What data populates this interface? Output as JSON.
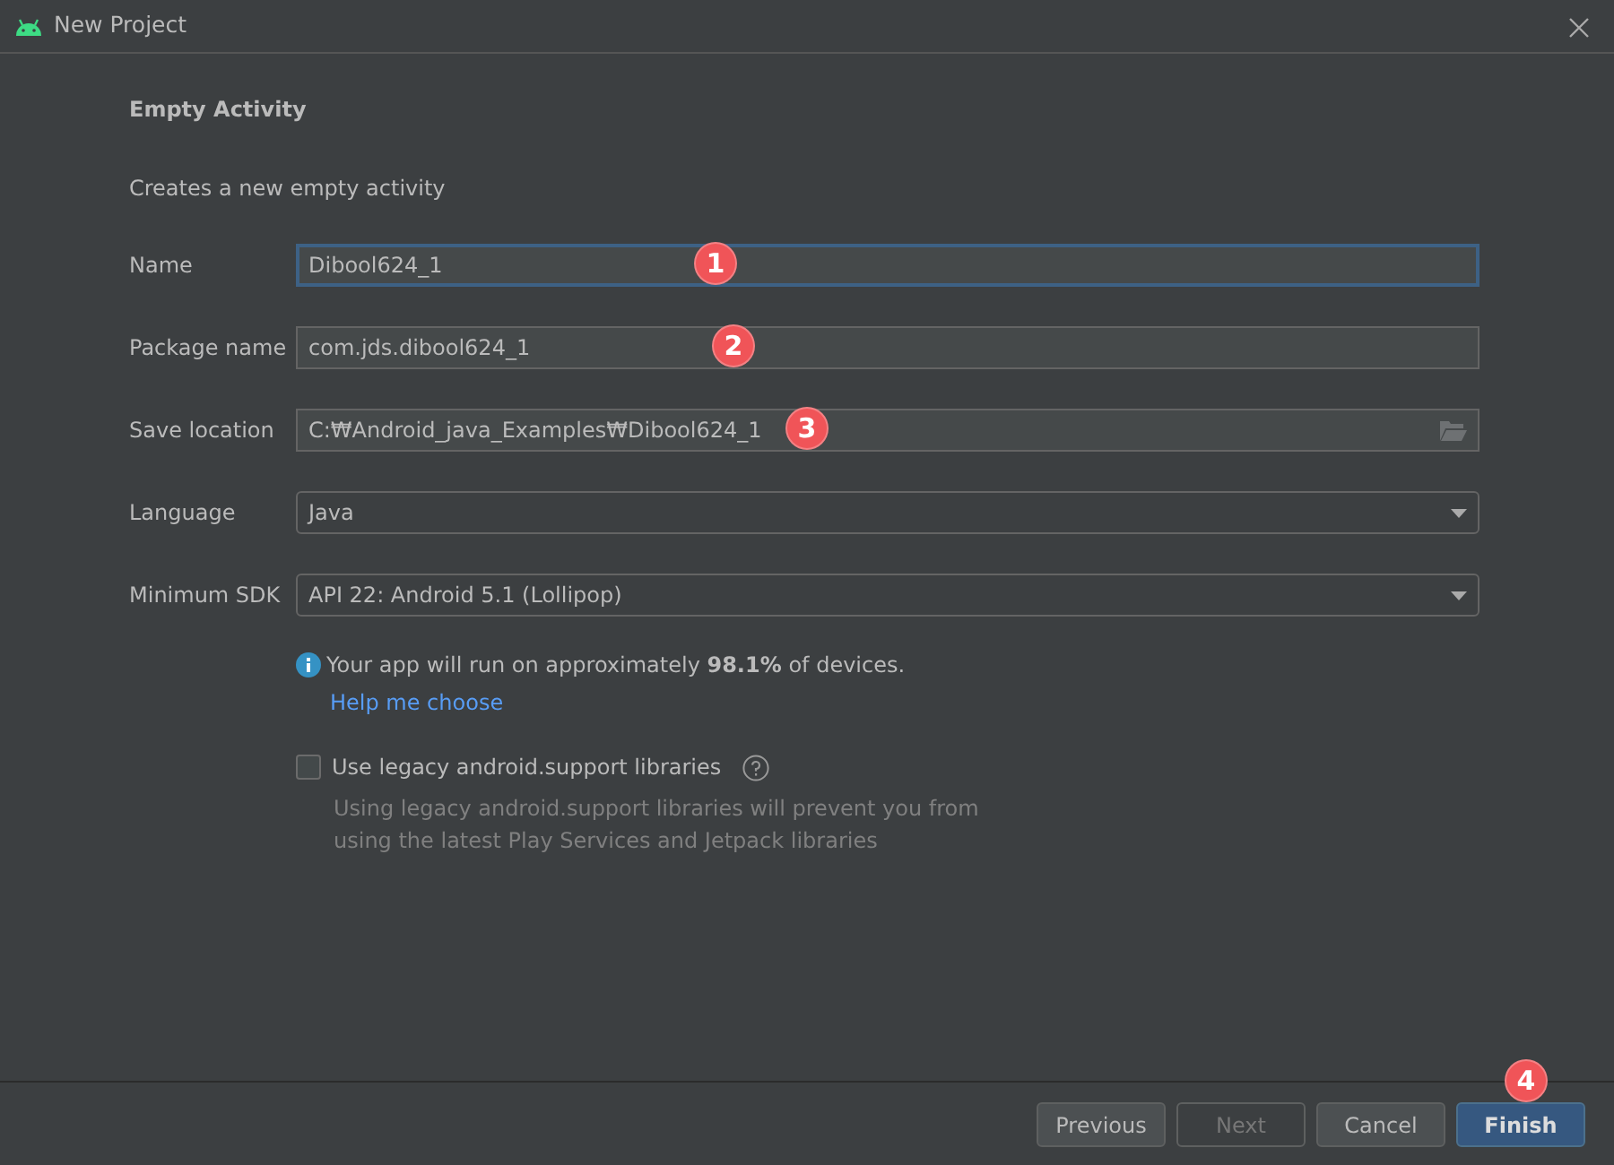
{
  "window": {
    "title": "New Project"
  },
  "heading": "Empty Activity",
  "description": "Creates a new empty activity",
  "fields": [
    {
      "label": "Name",
      "kind": "text",
      "value": "Dibool624_1",
      "focused": true,
      "marker": "1"
    },
    {
      "label": "Package name",
      "kind": "text",
      "value": "com.jds.dibool624_1",
      "focused": false,
      "marker": "2"
    },
    {
      "label": "Save location",
      "kind": "path",
      "value": "C:₩Android_java_Examples₩Dibool624_1",
      "focused": false,
      "marker": "3"
    },
    {
      "label": "Language",
      "kind": "dropdown",
      "value": "Java",
      "focused": false
    },
    {
      "label": "Minimum SDK",
      "kind": "dropdown",
      "value": "API 22: Android 5.1 (Lollipop)",
      "focused": false
    }
  ],
  "info": {
    "text": "Your app will run on approximately **98.1%** of devices.",
    "link": "Help me choose"
  },
  "legacy": {
    "label": "Use legacy android.support libraries",
    "checked": false,
    "note": "Using legacy android.support libraries will prevent you from using the latest Play Services and Jetpack libraries"
  },
  "buttons": [
    {
      "label": "Previous",
      "disabled": false,
      "primary": false
    },
    {
      "label": "Next",
      "disabled": true,
      "primary": false
    },
    {
      "label": "Cancel",
      "disabled": false,
      "primary": false
    },
    {
      "label": "Finish",
      "disabled": false,
      "primary": true,
      "marker": "4"
    }
  ]
}
